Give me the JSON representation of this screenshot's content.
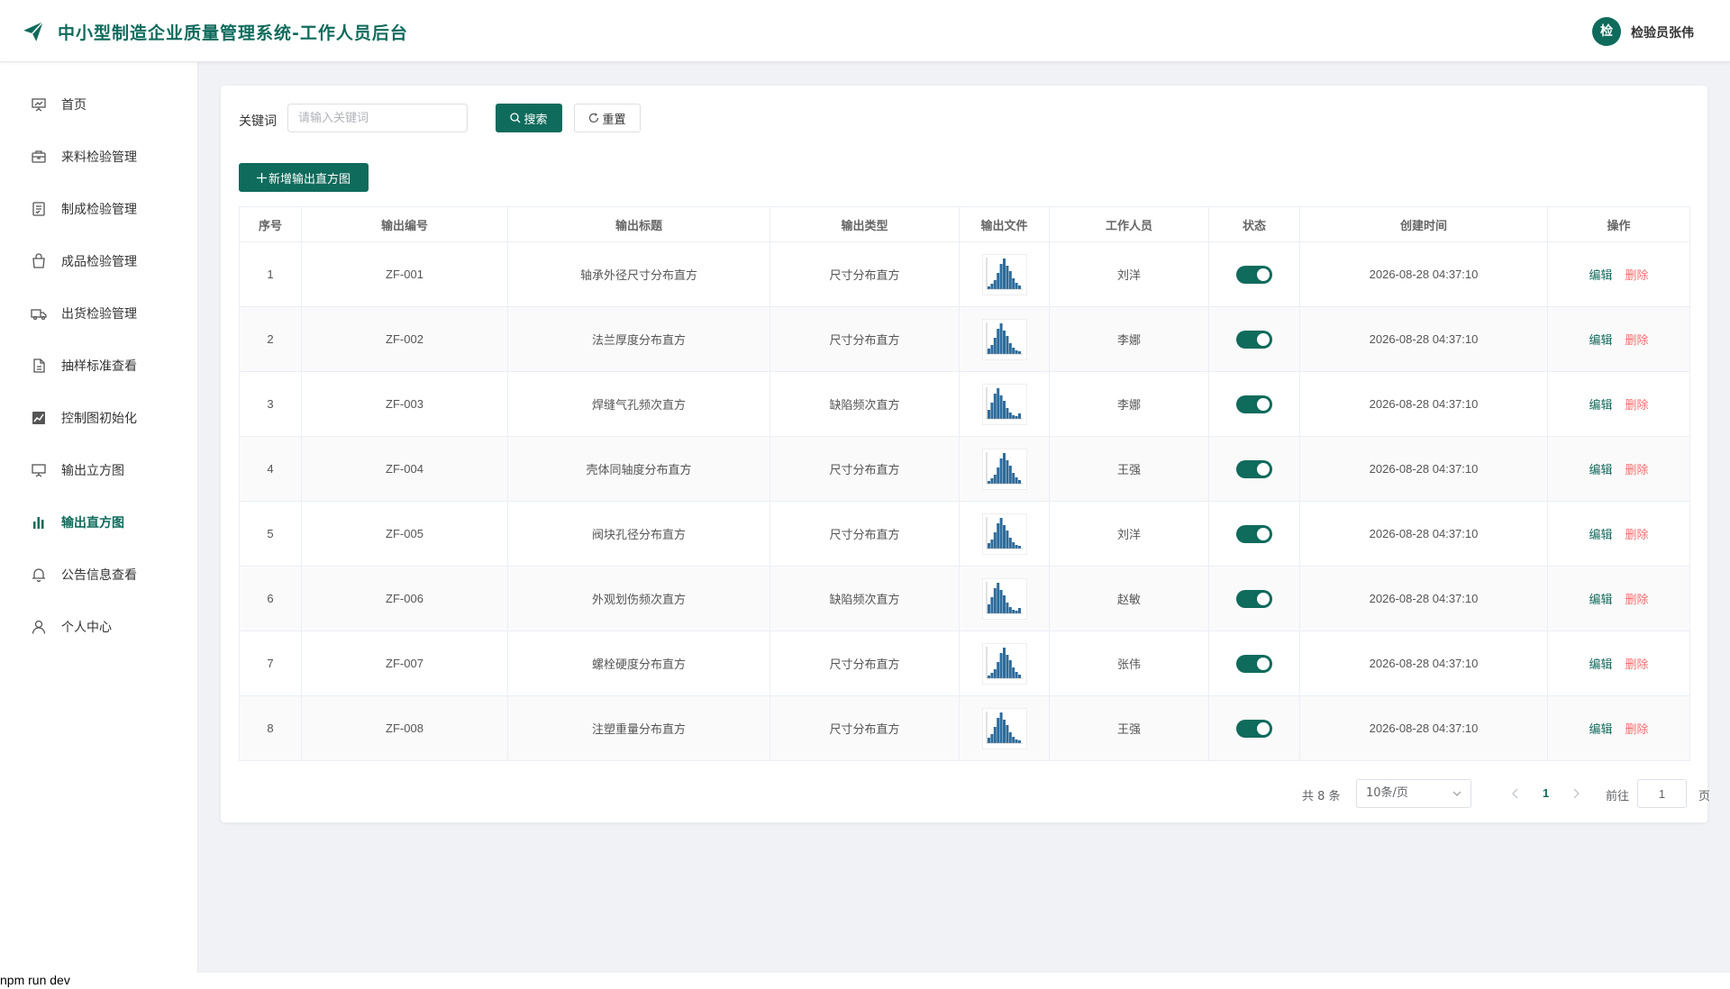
{
  "header": {
    "app_title": "中小型制造企业质量管理系统-工作人员后台",
    "user_avatar_text": "检",
    "user_name": "检验员张伟"
  },
  "sidebar": {
    "active_index": 8,
    "items": [
      {
        "label": "首页",
        "icon": "presentation-icon"
      },
      {
        "label": "来料检验管理",
        "icon": "box-icon"
      },
      {
        "label": "制成检验管理",
        "icon": "checklist-icon"
      },
      {
        "label": "成品检验管理",
        "icon": "bag-icon"
      },
      {
        "label": "出货检验管理",
        "icon": "truck-icon"
      },
      {
        "label": "抽样标准查看",
        "icon": "document-icon"
      },
      {
        "label": "控制图初始化",
        "icon": "line-chart-icon"
      },
      {
        "label": "输出立方图",
        "icon": "board-icon"
      },
      {
        "label": "输出直方图",
        "icon": "histogram-icon"
      },
      {
        "label": "公告信息查看",
        "icon": "bell-icon"
      },
      {
        "label": "个人中心",
        "icon": "user-icon"
      }
    ]
  },
  "search": {
    "keyword_label": "关键词",
    "keyword_placeholder": "请输入关键词",
    "keyword_value": "",
    "search_label": "搜索",
    "reset_label": "重置",
    "add_label": "新增输出直方图"
  },
  "table": {
    "columns": [
      "序号",
      "输出编号",
      "输出标题",
      "输出类型",
      "输出文件",
      "工作人员",
      "状态",
      "创建时间",
      "操作"
    ],
    "edit_label": "编辑",
    "delete_label": "删除",
    "rows": [
      {
        "index": "1",
        "code": "ZF-001",
        "title": "轴承外径尺寸分布直方",
        "type": "尺寸分布直方",
        "file": "histogram-thumbnail",
        "staff": "刘洋",
        "status": true,
        "created": "2026-08-28 04:37:10"
      },
      {
        "index": "2",
        "code": "ZF-002",
        "title": "法兰厚度分布直方",
        "type": "尺寸分布直方",
        "file": "histogram-thumbnail",
        "staff": "李娜",
        "status": true,
        "created": "2026-08-28 04:37:10"
      },
      {
        "index": "3",
        "code": "ZF-003",
        "title": "焊缝气孔频次直方",
        "type": "缺陷频次直方",
        "file": "histogram-thumbnail",
        "staff": "李娜",
        "status": true,
        "created": "2026-08-28 04:37:10"
      },
      {
        "index": "4",
        "code": "ZF-004",
        "title": "壳体同轴度分布直方",
        "type": "尺寸分布直方",
        "file": "histogram-thumbnail",
        "staff": "王强",
        "status": true,
        "created": "2026-08-28 04:37:10"
      },
      {
        "index": "5",
        "code": "ZF-005",
        "title": "阀块孔径分布直方",
        "type": "尺寸分布直方",
        "file": "histogram-thumbnail",
        "staff": "刘洋",
        "status": true,
        "created": "2026-08-28 04:37:10"
      },
      {
        "index": "6",
        "code": "ZF-006",
        "title": "外观划伤频次直方",
        "type": "缺陷频次直方",
        "file": "histogram-thumbnail",
        "staff": "赵敏",
        "status": true,
        "created": "2026-08-28 04:37:10"
      },
      {
        "index": "7",
        "code": "ZF-007",
        "title": "螺栓硬度分布直方",
        "type": "尺寸分布直方",
        "file": "histogram-thumbnail",
        "staff": "张伟",
        "status": true,
        "created": "2026-08-28 04:37:10"
      },
      {
        "index": "8",
        "code": "ZF-008",
        "title": "注塑重量分布直方",
        "type": "尺寸分布直方",
        "file": "histogram-thumbnail",
        "staff": "王强",
        "status": true,
        "created": "2026-08-28 04:37:10"
      }
    ]
  },
  "pagination": {
    "total_text": "共 8 条",
    "page_size": "10条/页",
    "current_page": "1",
    "goto_label": "前往",
    "goto_value": "1",
    "page_suffix": "页"
  },
  "status_bar": {
    "text": "npm run dev"
  },
  "colors": {
    "primary": "#0f6b5c",
    "danger": "#f56c6c",
    "chart_bar": "#2e6b9a"
  }
}
